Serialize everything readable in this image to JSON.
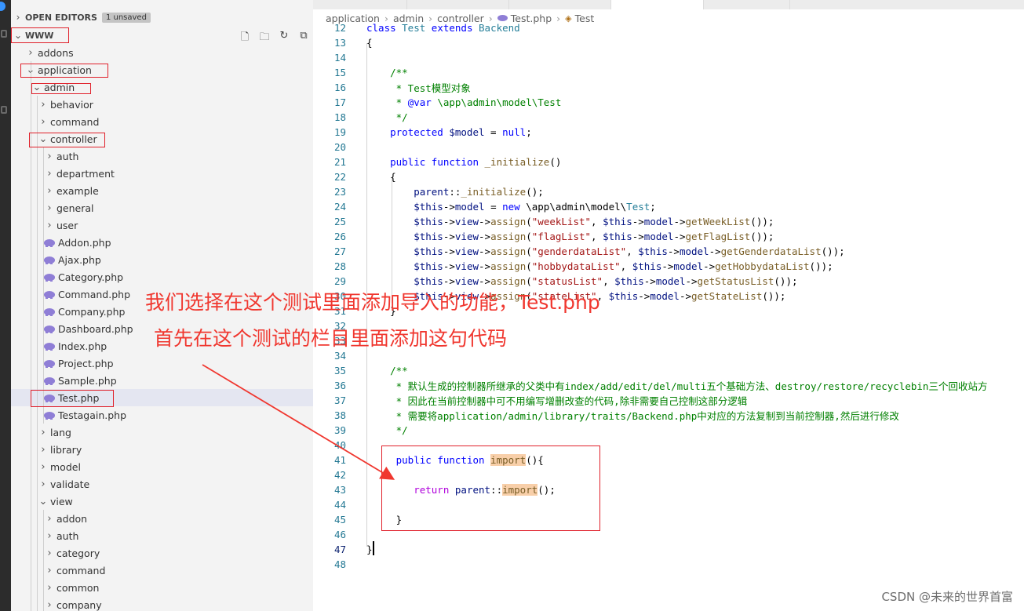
{
  "explorer": {
    "open_editors_label": "OPEN EDITORS",
    "unsaved_badge": "1 unsaved",
    "root_label": "WWW",
    "toolbar_icons": [
      "new-file-icon",
      "new-folder-icon",
      "refresh-icon",
      "collapse-all-icon"
    ],
    "tree": [
      {
        "label": "addons",
        "kind": "folder",
        "expanded": false,
        "depth": 1
      },
      {
        "label": "application",
        "kind": "folder",
        "expanded": true,
        "depth": 1
      },
      {
        "label": "admin",
        "kind": "folder",
        "expanded": true,
        "depth": 2
      },
      {
        "label": "behavior",
        "kind": "folder",
        "expanded": false,
        "depth": 3
      },
      {
        "label": "command",
        "kind": "folder",
        "expanded": false,
        "depth": 3
      },
      {
        "label": "controller",
        "kind": "folder",
        "expanded": true,
        "depth": 3
      },
      {
        "label": "auth",
        "kind": "folder",
        "expanded": false,
        "depth": 4
      },
      {
        "label": "department",
        "kind": "folder",
        "expanded": false,
        "depth": 4
      },
      {
        "label": "example",
        "kind": "folder",
        "expanded": false,
        "depth": 4
      },
      {
        "label": "general",
        "kind": "folder",
        "expanded": false,
        "depth": 4
      },
      {
        "label": "user",
        "kind": "folder",
        "expanded": false,
        "depth": 4
      },
      {
        "label": "Addon.php",
        "kind": "php",
        "depth": 4
      },
      {
        "label": "Ajax.php",
        "kind": "php",
        "depth": 4
      },
      {
        "label": "Category.php",
        "kind": "php",
        "depth": 4
      },
      {
        "label": "Command.php",
        "kind": "php",
        "depth": 4
      },
      {
        "label": "Company.php",
        "kind": "php",
        "depth": 4
      },
      {
        "label": "Dashboard.php",
        "kind": "php",
        "depth": 4
      },
      {
        "label": "Index.php",
        "kind": "php",
        "depth": 4
      },
      {
        "label": "Project.php",
        "kind": "php",
        "depth": 4
      },
      {
        "label": "Sample.php",
        "kind": "php",
        "depth": 4
      },
      {
        "label": "Test.php",
        "kind": "php",
        "depth": 4,
        "selected": true
      },
      {
        "label": "Testagain.php",
        "kind": "php",
        "depth": 4
      },
      {
        "label": "lang",
        "kind": "folder",
        "expanded": false,
        "depth": 3
      },
      {
        "label": "library",
        "kind": "folder",
        "expanded": false,
        "depth": 3
      },
      {
        "label": "model",
        "kind": "folder",
        "expanded": false,
        "depth": 3
      },
      {
        "label": "validate",
        "kind": "folder",
        "expanded": false,
        "depth": 3
      },
      {
        "label": "view",
        "kind": "folder",
        "expanded": true,
        "depth": 3
      },
      {
        "label": "addon",
        "kind": "folder",
        "expanded": false,
        "depth": 4
      },
      {
        "label": "auth",
        "kind": "folder",
        "expanded": false,
        "depth": 4
      },
      {
        "label": "category",
        "kind": "folder",
        "expanded": false,
        "depth": 4
      },
      {
        "label": "command",
        "kind": "folder",
        "expanded": false,
        "depth": 4
      },
      {
        "label": "common",
        "kind": "folder",
        "expanded": false,
        "depth": 4
      },
      {
        "label": "company",
        "kind": "folder",
        "expanded": false,
        "depth": 4
      }
    ]
  },
  "breadcrumb": {
    "parts": [
      "application",
      "admin",
      "controller"
    ],
    "file": "Test.php",
    "symbol": "Test"
  },
  "editor": {
    "current_line": "47",
    "lines": [
      {
        "n": "12",
        "segs": [
          [
            "class ",
            "kw"
          ],
          [
            "Test ",
            "cls-n"
          ],
          [
            "extends ",
            "kw"
          ],
          [
            "Backend",
            "cls-n"
          ]
        ]
      },
      {
        "n": "13",
        "segs": [
          [
            "{",
            ""
          ]
        ]
      },
      {
        "n": "14",
        "segs": []
      },
      {
        "n": "15",
        "segs": [
          [
            "    /**",
            "cmt"
          ]
        ]
      },
      {
        "n": "16",
        "segs": [
          [
            "     * Test模型对象",
            "cmt"
          ]
        ]
      },
      {
        "n": "17",
        "segs": [
          [
            "     * ",
            "cmt"
          ],
          [
            "@var",
            "kw"
          ],
          [
            " \\app\\admin\\model\\Test",
            "cmt"
          ]
        ]
      },
      {
        "n": "18",
        "segs": [
          [
            "     */",
            "cmt"
          ]
        ]
      },
      {
        "n": "19",
        "segs": [
          [
            "    protected ",
            "kw"
          ],
          [
            "$model",
            "var"
          ],
          [
            " = ",
            ""
          ],
          [
            "null",
            "kw"
          ],
          [
            ";",
            ""
          ]
        ]
      },
      {
        "n": "20",
        "segs": []
      },
      {
        "n": "21",
        "segs": [
          [
            "    public ",
            "kw"
          ],
          [
            "function ",
            "kw"
          ],
          [
            "_initialize",
            "fn"
          ],
          [
            "()",
            ""
          ]
        ]
      },
      {
        "n": "22",
        "segs": [
          [
            "    {",
            ""
          ]
        ]
      },
      {
        "n": "23",
        "segs": [
          [
            "        parent",
            "var"
          ],
          [
            "::",
            ""
          ],
          [
            "_initialize",
            "fn"
          ],
          [
            "();",
            ""
          ]
        ]
      },
      {
        "n": "24",
        "segs": [
          [
            "        $this",
            "var"
          ],
          [
            "->",
            ""
          ],
          [
            "model",
            "var"
          ],
          [
            " = ",
            ""
          ],
          [
            "new ",
            "kw"
          ],
          [
            "\\app\\admin\\model\\",
            ""
          ],
          [
            "Test",
            "cls-n"
          ],
          [
            ";",
            ""
          ]
        ]
      },
      {
        "n": "25",
        "segs": [
          [
            "        $this",
            "var"
          ],
          [
            "->",
            ""
          ],
          [
            "view",
            "var"
          ],
          [
            "->",
            ""
          ],
          [
            "assign",
            "fn"
          ],
          [
            "(",
            ""
          ],
          [
            "\"weekList\"",
            "str"
          ],
          [
            ", ",
            ""
          ],
          [
            "$this",
            "var"
          ],
          [
            "->",
            ""
          ],
          [
            "model",
            "var"
          ],
          [
            "->",
            ""
          ],
          [
            "getWeekList",
            "fn"
          ],
          [
            "());",
            ""
          ]
        ]
      },
      {
        "n": "26",
        "segs": [
          [
            "        $this",
            "var"
          ],
          [
            "->",
            ""
          ],
          [
            "view",
            "var"
          ],
          [
            "->",
            ""
          ],
          [
            "assign",
            "fn"
          ],
          [
            "(",
            ""
          ],
          [
            "\"flagList\"",
            "str"
          ],
          [
            ", ",
            ""
          ],
          [
            "$this",
            "var"
          ],
          [
            "->",
            ""
          ],
          [
            "model",
            "var"
          ],
          [
            "->",
            ""
          ],
          [
            "getFlagList",
            "fn"
          ],
          [
            "());",
            ""
          ]
        ]
      },
      {
        "n": "27",
        "segs": [
          [
            "        $this",
            "var"
          ],
          [
            "->",
            ""
          ],
          [
            "view",
            "var"
          ],
          [
            "->",
            ""
          ],
          [
            "assign",
            "fn"
          ],
          [
            "(",
            ""
          ],
          [
            "\"genderdataList\"",
            "str"
          ],
          [
            ", ",
            ""
          ],
          [
            "$this",
            "var"
          ],
          [
            "->",
            ""
          ],
          [
            "model",
            "var"
          ],
          [
            "->",
            ""
          ],
          [
            "getGenderdataList",
            "fn"
          ],
          [
            "());",
            ""
          ]
        ]
      },
      {
        "n": "28",
        "segs": [
          [
            "        $this",
            "var"
          ],
          [
            "->",
            ""
          ],
          [
            "view",
            "var"
          ],
          [
            "->",
            ""
          ],
          [
            "assign",
            "fn"
          ],
          [
            "(",
            ""
          ],
          [
            "\"hobbydataList\"",
            "str"
          ],
          [
            ", ",
            ""
          ],
          [
            "$this",
            "var"
          ],
          [
            "->",
            ""
          ],
          [
            "model",
            "var"
          ],
          [
            "->",
            ""
          ],
          [
            "getHobbydataList",
            "fn"
          ],
          [
            "());",
            ""
          ]
        ]
      },
      {
        "n": "29",
        "segs": [
          [
            "        $this",
            "var"
          ],
          [
            "->",
            ""
          ],
          [
            "view",
            "var"
          ],
          [
            "->",
            ""
          ],
          [
            "assign",
            "fn"
          ],
          [
            "(",
            ""
          ],
          [
            "\"statusList\"",
            "str"
          ],
          [
            ", ",
            ""
          ],
          [
            "$this",
            "var"
          ],
          [
            "->",
            ""
          ],
          [
            "model",
            "var"
          ],
          [
            "->",
            ""
          ],
          [
            "getStatusList",
            "fn"
          ],
          [
            "());",
            ""
          ]
        ]
      },
      {
        "n": "30",
        "segs": [
          [
            "        $this",
            "var"
          ],
          [
            "->",
            ""
          ],
          [
            "view",
            "var"
          ],
          [
            "->",
            ""
          ],
          [
            "assign",
            "fn"
          ],
          [
            "(",
            ""
          ],
          [
            "\"stateList\"",
            "str"
          ],
          [
            ", ",
            ""
          ],
          [
            "$this",
            "var"
          ],
          [
            "->",
            ""
          ],
          [
            "model",
            "var"
          ],
          [
            "->",
            ""
          ],
          [
            "getStateList",
            "fn"
          ],
          [
            "());",
            ""
          ]
        ]
      },
      {
        "n": "31",
        "segs": [
          [
            "    }",
            ""
          ]
        ]
      },
      {
        "n": "32",
        "segs": []
      },
      {
        "n": "33",
        "segs": []
      },
      {
        "n": "34",
        "segs": []
      },
      {
        "n": "35",
        "segs": [
          [
            "    /**",
            "cmt"
          ]
        ]
      },
      {
        "n": "36",
        "segs": [
          [
            "     * 默认生成的控制器所继承的父类中有index/add/edit/del/multi五个基础方法、destroy/restore/recyclebin三个回收站方",
            "cmt"
          ]
        ]
      },
      {
        "n": "37",
        "segs": [
          [
            "     * 因此在当前控制器中可不用编写增删改查的代码,除非需要自己控制这部分逻辑",
            "cmt"
          ]
        ]
      },
      {
        "n": "38",
        "segs": [
          [
            "     * 需要将application/admin/library/traits/Backend.php中对应的方法复制到当前控制器,然后进行修改",
            "cmt"
          ]
        ]
      },
      {
        "n": "39",
        "segs": [
          [
            "     */",
            "cmt"
          ]
        ]
      },
      {
        "n": "40",
        "segs": []
      },
      {
        "n": "41",
        "segs": [
          [
            "     public ",
            "kw"
          ],
          [
            "function ",
            "kw"
          ],
          [
            "import",
            "fn hl"
          ],
          [
            "(){",
            ""
          ]
        ]
      },
      {
        "n": "42",
        "segs": []
      },
      {
        "n": "43",
        "segs": [
          [
            "        return ",
            "kw2"
          ],
          [
            "parent",
            "var"
          ],
          [
            "::",
            ""
          ],
          [
            "import",
            "fn hl"
          ],
          [
            "();",
            ""
          ]
        ]
      },
      {
        "n": "44",
        "segs": []
      },
      {
        "n": "45",
        "segs": [
          [
            "     }",
            ""
          ]
        ]
      },
      {
        "n": "46",
        "segs": []
      },
      {
        "n": "47",
        "segs": [
          [
            "}",
            ""
          ]
        ]
      },
      {
        "n": "48",
        "segs": []
      }
    ]
  },
  "annotations": {
    "line1": "我们选择在这个测试里面添加导入的功能，Test.php",
    "line2": "首先在这个测试的栏目里面添加这句代码",
    "color": "#f0372f"
  },
  "watermark": "CSDN @未来的世界首富"
}
